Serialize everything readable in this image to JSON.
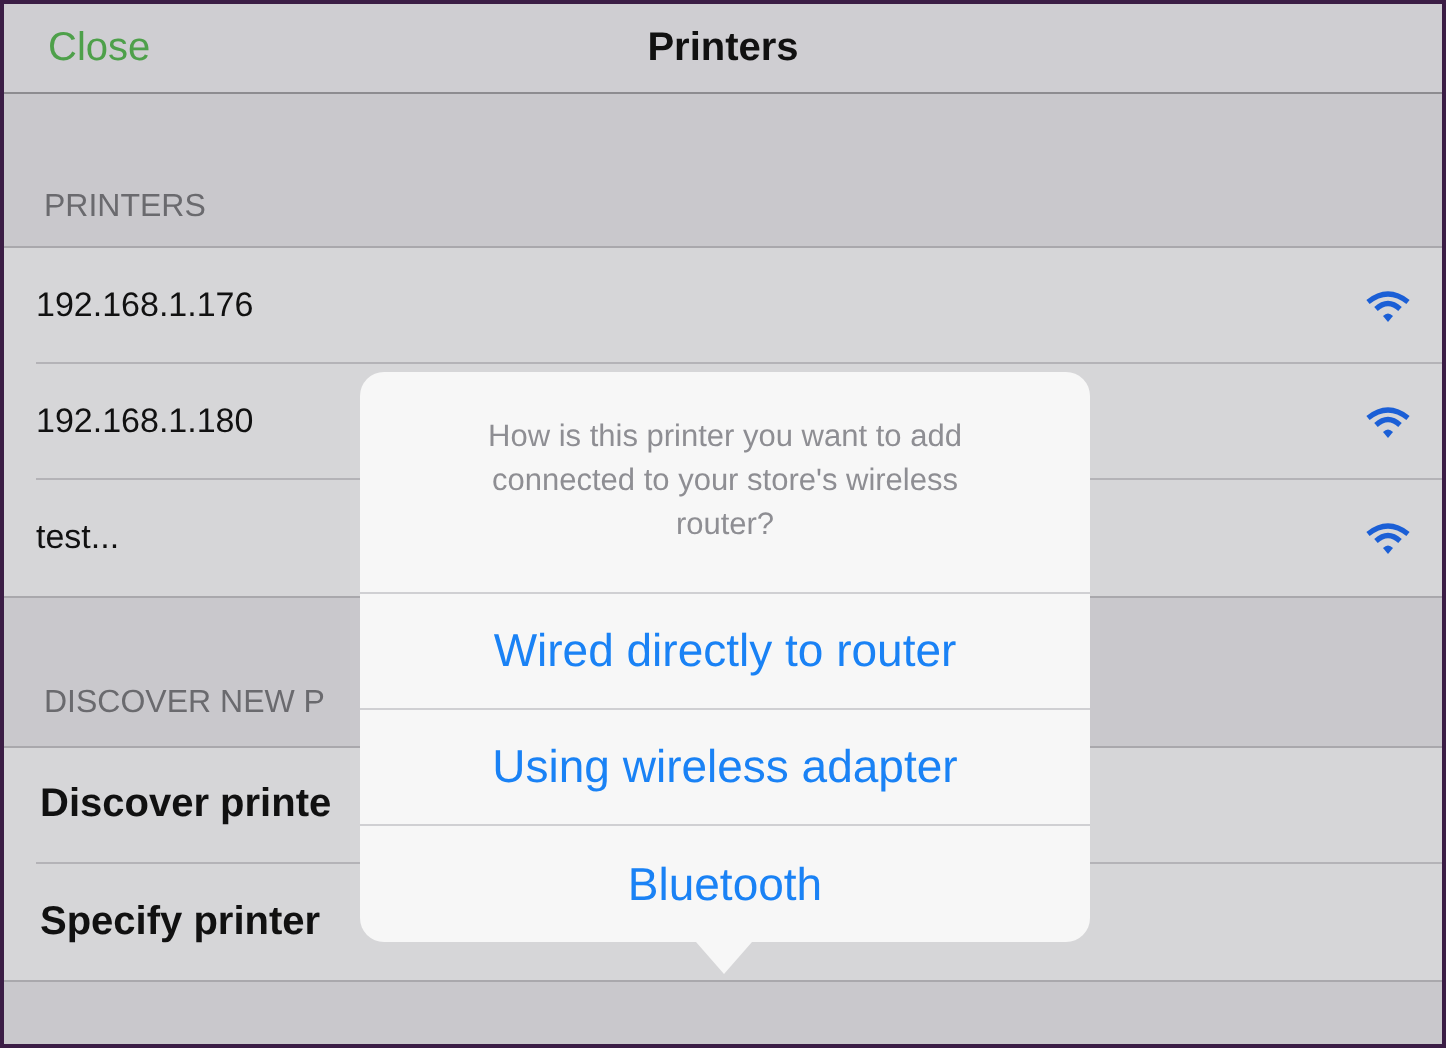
{
  "nav_bar": {
    "close": "Close",
    "title": "Printers"
  },
  "printers": {
    "header": "PRINTERS",
    "items": [
      {
        "name": "192.168.1.176"
      },
      {
        "name": "192.168.1.180"
      },
      {
        "name": "test..."
      }
    ]
  },
  "discover": {
    "header": "DISCOVER NEW P",
    "rows": [
      {
        "label": "Discover printe"
      },
      {
        "label": "Specify printer"
      }
    ]
  },
  "popover": {
    "message": "How is this printer you want to add connected to your store's wireless router?",
    "options": [
      "Wired directly to router",
      "Using wireless adapter",
      "Bluetooth"
    ]
  }
}
